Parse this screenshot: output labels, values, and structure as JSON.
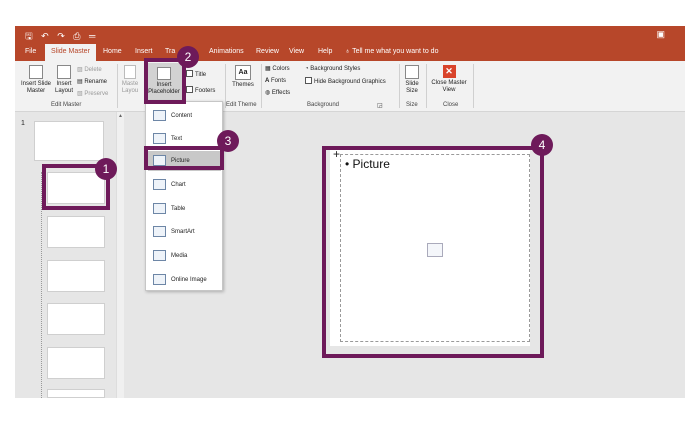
{
  "colors": {
    "brand": "#b7472a",
    "highlight": "#6e1a5a",
    "menu_highlight": "#c8c8c8"
  },
  "titlebar": {
    "quick_access": "🖫 ↶ ↷ ⎙ ═",
    "window_icon": "▣"
  },
  "tabs": [
    {
      "label": "File"
    },
    {
      "label": "Slide Master"
    },
    {
      "label": "Home"
    },
    {
      "label": "Insert"
    },
    {
      "label": "Tra"
    },
    {
      "label": "Animations"
    },
    {
      "label": "Review"
    },
    {
      "label": "View"
    },
    {
      "label": "Help"
    }
  ],
  "tellme": "Tell me what you want to do",
  "ribbon": {
    "insert_slide_master": "Insert Slide Master",
    "insert_layout": "Insert Layout",
    "delete": "Delete",
    "rename": "Rename",
    "preserve": "Preserve",
    "edit_master_label": "Edit Master",
    "master_layout": "Maste Layou",
    "insert_placeholder": "Insert Placeholder",
    "title": "Title",
    "footers": "Footers",
    "themes": "Themes",
    "edit_theme_label": "Edit Theme",
    "colors": "Colors",
    "fonts": "Fonts",
    "effects": "Effects",
    "background_styles": "Background Styles",
    "hide_background_graphics": "Hide Background Graphics",
    "background_label": "Background",
    "slide_size": "Slide Size",
    "size_label": "Size",
    "close_master_view": "Close Master View",
    "close_label": "Close"
  },
  "thumbpane": {
    "slide_number": "1"
  },
  "menu": {
    "items": [
      {
        "label": "Content",
        "icon": "content-icon"
      },
      {
        "label": "Text",
        "icon": "text-icon"
      },
      {
        "label": "Picture",
        "icon": "picture-icon"
      },
      {
        "label": "Chart",
        "icon": "chart-icon"
      },
      {
        "label": "Table",
        "icon": "table-icon"
      },
      {
        "label": "SmartArt",
        "icon": "smartart-icon"
      },
      {
        "label": "Media",
        "icon": "media-icon"
      },
      {
        "label": "Online Image",
        "icon": "online-image-icon"
      }
    ]
  },
  "slide": {
    "placeholder_text": "• Picture"
  },
  "badges": [
    "1",
    "2",
    "3",
    "4"
  ]
}
